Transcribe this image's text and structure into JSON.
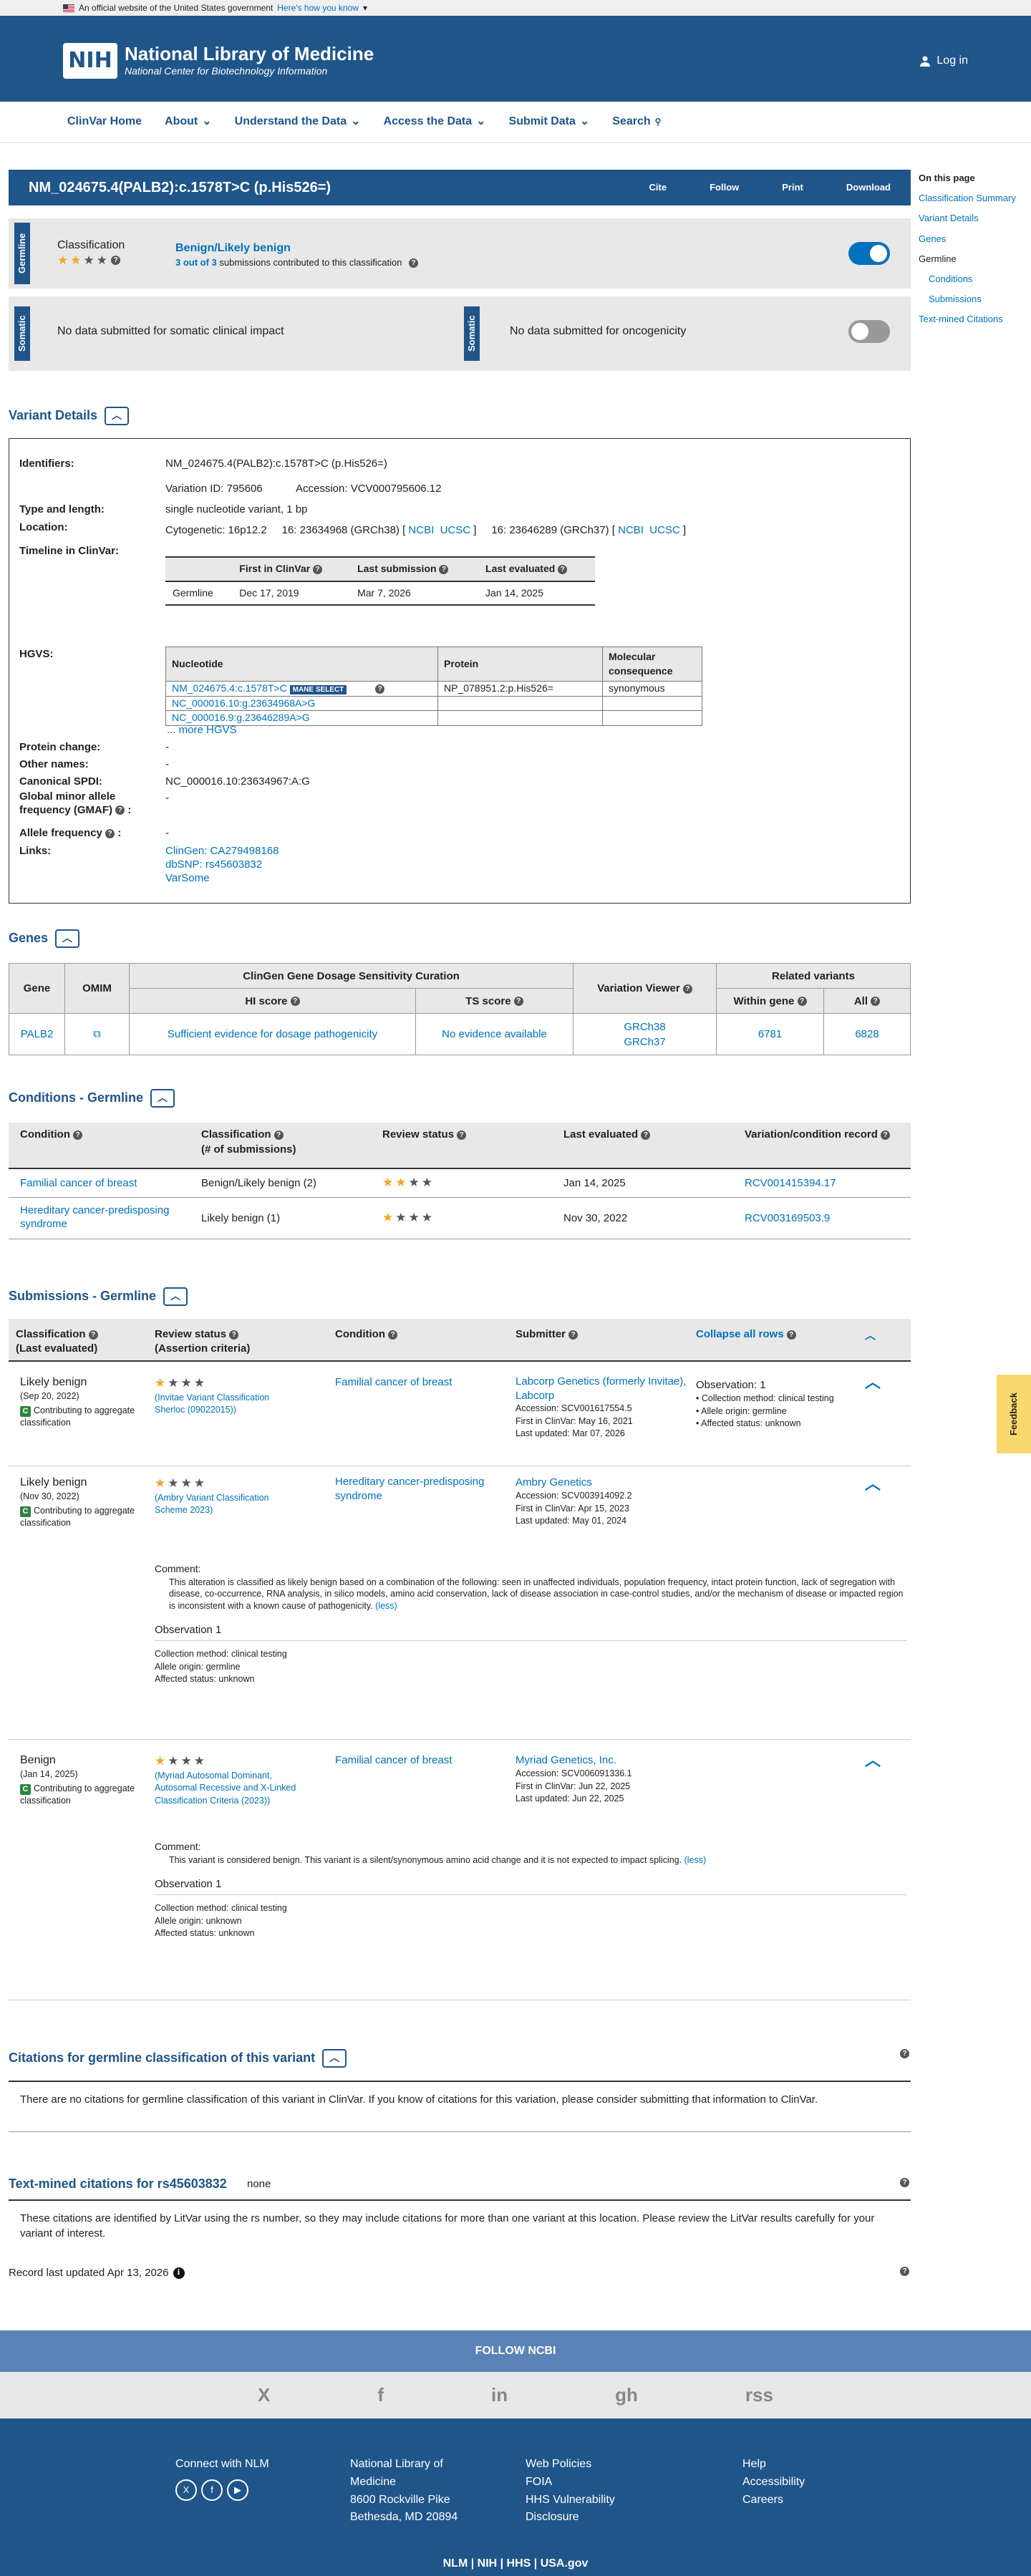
{
  "gov_banner": {
    "text": "An official website of the United States government",
    "link": "Here's how you know"
  },
  "header": {
    "logo_box": "NIH",
    "title": "National Library of Medicine",
    "subtitle": "National Center for Biotechnology Information",
    "login": "Log in"
  },
  "nav": {
    "items": [
      "ClinVar Home",
      "About",
      "Understand the Data",
      "Access the Data",
      "Submit Data",
      "Search"
    ]
  },
  "variant": {
    "title": "NM_024675.4(PALB2):c.1578T>C (p.His526=)",
    "actions": [
      "Cite",
      "Follow",
      "Print",
      "Download"
    ]
  },
  "on_this_page": {
    "heading": "On this page",
    "items": [
      "Classification Summary",
      "Variant Details",
      "Genes",
      "Germline",
      "Conditions",
      "Submissions",
      "Text-mined Citations"
    ]
  },
  "germline_panel": {
    "tab": "Germline",
    "label": "Classification",
    "classification": "Benign/Likely benign",
    "submissions_prefix": "3 out of 3",
    "submissions_suffix": " submissions contributed to this classification"
  },
  "somatic_panel": {
    "tab": "Somatic",
    "left_text": "No data submitted for somatic clinical impact",
    "tab2": "Somatic",
    "right_text": "No data submitted for oncogenicity"
  },
  "details": {
    "heading": "Variant Details",
    "identifiers_label": "Identifiers:",
    "identifiers": "NM_024675.4(PALB2):c.1578T>C (p.His526=)",
    "variation_id": "Variation ID: 795606",
    "accession": "Accession: VCV000795606.12",
    "type_label": "Type and length:",
    "type": "single nucleotide variant, 1 bp",
    "location_label": "Location:",
    "cyto": "Cytogenetic: 16p12.2",
    "loc38": "16: 23634968 (GRCh38) [",
    "loc37": "16: 23646289 (GRCh37) [",
    "ncbi": "NCBI",
    "ucsc": "UCSC",
    "bracket": "]",
    "timeline_label": "Timeline in ClinVar:",
    "timeline_headers": [
      "First in ClinVar",
      "Last submission",
      "Last evaluated"
    ],
    "timeline_row": [
      "Germline",
      "Dec 17, 2019",
      "Mar 7, 2026",
      "Jan 14, 2025"
    ],
    "hgvs_label": "HGVS:",
    "hgvs_headers": [
      "Nucleotide",
      "Protein",
      "Molecular consequence"
    ],
    "hgvs_rows": [
      [
        "NM_024675.4:c.1578T>C",
        "NP_078951.2:p.His526=",
        "synonymous"
      ],
      [
        "NC_000016.10:g.23634968A>G",
        "",
        ""
      ],
      [
        "NC_000016.9:g.23646289A>G",
        "",
        ""
      ]
    ],
    "mane": "MANE SELECT",
    "more_hgvs": "... more HGVS",
    "protein_change_label": "Protein change:",
    "protein_change": "-",
    "other_names_label": "Other names:",
    "other_names": "-",
    "spdi_label": "Canonical SPDI:",
    "spdi": "NC_000016.10:23634967:A:G",
    "gmaf_label": "Global minor allele frequency (GMAF)",
    "gmaf_colon": ":",
    "gmaf": "-",
    "af_label": "Allele frequency",
    "af_colon": ":",
    "af": "-",
    "links_label": "Links:",
    "links": [
      "ClinGen: CA279498168",
      "dbSNP: rs45603832",
      "VarSome"
    ]
  },
  "genes": {
    "heading": "Genes",
    "headers": {
      "gene": "Gene",
      "omim": "OMIM",
      "clingen": "ClinGen Gene Dosage Sensitivity Curation",
      "hi": "HI score",
      "ts": "TS score",
      "viewer": "Variation Viewer",
      "related": "Related variants",
      "within": "Within gene",
      "all": "All"
    },
    "row": {
      "gene": "PALB2",
      "hi": "Sufficient evidence for dosage pathogenicity",
      "ts": "No evidence available",
      "grch38": "GRCh38",
      "grch37": "GRCh37",
      "within": "6781",
      "all": "6828"
    }
  },
  "conditions": {
    "heading": "Conditions - Germline",
    "headers": [
      "Condition",
      "Classification",
      "(# of submissions)",
      "Review status",
      "Last evaluated",
      "Variation/condition record"
    ],
    "rows": [
      {
        "condition": "Familial cancer of breast",
        "classification": "Benign/Likely benign (2)",
        "stars": 2,
        "last": "Jan 14, 2025",
        "record": "RCV001415394.17"
      },
      {
        "condition": "Hereditary cancer-predisposing syndrome",
        "classification": "Likely benign (1)",
        "stars": 1,
        "last": "Nov 30, 2022",
        "record": "RCV003169503.9"
      }
    ]
  },
  "submissions": {
    "heading": "Submissions - Germline",
    "headers": {
      "classification": "Classification",
      "last_eval": "(Last evaluated)",
      "review": "Review status",
      "criteria": "(Assertion criteria)",
      "condition": "Condition",
      "submitter": "Submitter",
      "collapse": "Collapse all rows"
    },
    "contributing": "Contributing to aggregate classification",
    "rows": [
      {
        "class": "Likely benign",
        "date": "(Sep 20, 2022)",
        "criteria": "(Invitae Variant Classification Sherloc (09022015))",
        "condition": "Familial cancer of breast",
        "submitter": "Labcorp Genetics (formerly Invitae), Labcorp",
        "accession": "Accession: SCV001617554.5",
        "first": "First in ClinVar: May 16, 2021",
        "updated": "Last updated: Mar 07, 2026",
        "obs": "Observation: 1",
        "obs_items": [
          "Collection method: clinical testing",
          "Allele origin: germline",
          "Affected status: unknown"
        ]
      },
      {
        "class": "Likely benign",
        "date": "(Nov 30, 2022)",
        "criteria": "(Ambry Variant Classification Scheme 2023)",
        "condition": "Hereditary cancer-predisposing syndrome",
        "submitter": "Ambry Genetics",
        "accession": "Accession: SCV003914092.2",
        "first": "First in ClinVar: Apr 15, 2023",
        "updated": "Last updated: May 01, 2024",
        "comment_label": "Comment:",
        "comment": "This alteration is classified as likely benign based on a combination of the following: seen in unaffected individuals, population frequency, intact protein function, lack of segregation with disease, co-occurrence, RNA analysis, in silico models, amino acid conservation, lack of disease association in case-control studies, and/or the mechanism of disease or impacted region is inconsistent with a known cause of pathogenicity.",
        "less": "(less)",
        "obs_title": "Observation 1",
        "obs_items": [
          "Collection method: clinical testing",
          "Allele origin: germline",
          "Affected status: unknown"
        ]
      },
      {
        "class": "Benign",
        "date": "(Jan 14, 2025)",
        "criteria": "(Myriad Autosomal Dominant, Autosomal Recessive and X-Linked Classification Criteria (2023))",
        "condition": "Familial cancer of breast",
        "submitter": "Myriad Genetics, Inc.",
        "accession": "Accession: SCV006091336.1",
        "first": "First in ClinVar: Jun 22, 2025",
        "updated": "Last updated: Jun 22, 2025",
        "comment_label": "Comment:",
        "comment": "This variant is considered benign. This variant is a silent/synonymous amino acid change and it is not expected to impact splicing.",
        "less": "(less)",
        "obs_title": "Observation 1",
        "obs_items": [
          "Collection method: clinical testing",
          "Allele origin: unknown",
          "Affected status: unknown"
        ]
      }
    ]
  },
  "citations": {
    "heading": "Citations for germline classification of this variant",
    "text": "There are no citations for germline classification of this variant in ClinVar. If you know of citations for this variation, please consider submitting that information to ClinVar."
  },
  "textmined": {
    "heading": "Text-mined citations for rs45603832",
    "none": "none",
    "text": "These citations are identified by LitVar using the rs number, so they may include citations for more than one variant at this location. Please review the LitVar results carefully for your variant of interest."
  },
  "record_updated": "Record last updated Apr 13, 2026",
  "feedback": "Feedback",
  "footer": {
    "follow": "FOLLOW NCBI",
    "social": [
      "X",
      "f",
      "in",
      "gh",
      "rss"
    ],
    "connect": "Connect with NLM",
    "nlm": [
      "National Library of",
      "Medicine",
      "8600 Rockville Pike",
      "Bethesda, MD 20894"
    ],
    "policies": [
      "Web Policies",
      "FOIA",
      "HHS Vulnerability",
      "Disclosure"
    ],
    "help": [
      "Help",
      "Accessibility",
      "Careers"
    ],
    "bottom": "NLM | NIH | HHS | USA.gov"
  }
}
